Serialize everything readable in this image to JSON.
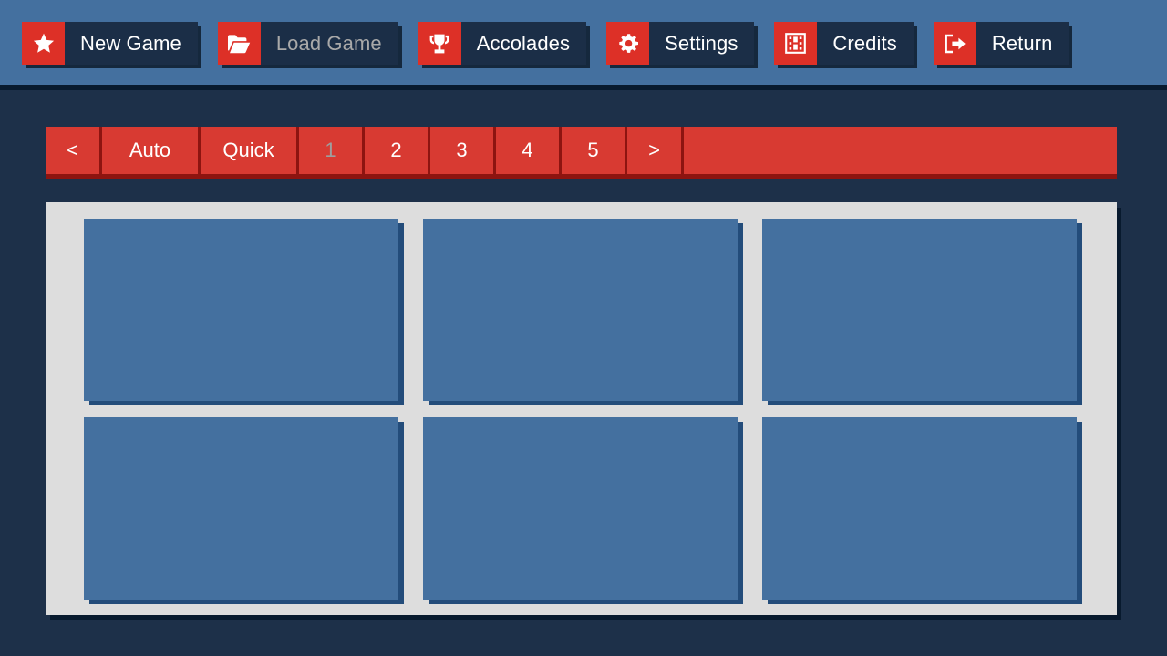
{
  "navbar": {
    "background_color": "#44709f",
    "accent_color": "#dd3027",
    "items": [
      {
        "label": "New Game",
        "icon": "star-icon",
        "state": "normal"
      },
      {
        "label": "Load Game",
        "icon": "folder-open-icon",
        "state": "current"
      },
      {
        "label": "Accolades",
        "icon": "trophy-icon",
        "state": "normal"
      },
      {
        "label": "Settings",
        "icon": "gear-icon",
        "state": "normal"
      },
      {
        "label": "Credits",
        "icon": "film-icon",
        "state": "normal"
      },
      {
        "label": "Return",
        "icon": "exit-icon",
        "state": "normal"
      }
    ]
  },
  "selector": {
    "background_color": "#d83a32",
    "shadow_color": "#8d1410",
    "buttons": [
      {
        "label": "<",
        "name": "page-prev",
        "width": "arrow",
        "state": "normal"
      },
      {
        "label": "Auto",
        "name": "page-auto",
        "width": "wide",
        "state": "normal"
      },
      {
        "label": "Quick",
        "name": "page-quick",
        "width": "wide",
        "state": "normal"
      },
      {
        "label": "1",
        "name": "page-1",
        "width": "num",
        "state": "current"
      },
      {
        "label": "2",
        "name": "page-2",
        "width": "num",
        "state": "normal"
      },
      {
        "label": "3",
        "name": "page-3",
        "width": "num",
        "state": "normal"
      },
      {
        "label": "4",
        "name": "page-4",
        "width": "num",
        "state": "normal"
      },
      {
        "label": "5",
        "name": "page-5",
        "width": "num",
        "state": "normal"
      },
      {
        "label": ">",
        "name": "page-next",
        "width": "arrow",
        "state": "normal"
      }
    ]
  },
  "slot_panel": {
    "background_color": "#dddddd",
    "slot_color": "#44709f",
    "slots": [
      {
        "caption": "",
        "empty": true
      },
      {
        "caption": "",
        "empty": true
      },
      {
        "caption": "",
        "empty": true
      },
      {
        "caption": "",
        "empty": true
      },
      {
        "caption": "",
        "empty": true
      },
      {
        "caption": "",
        "empty": true
      }
    ]
  }
}
